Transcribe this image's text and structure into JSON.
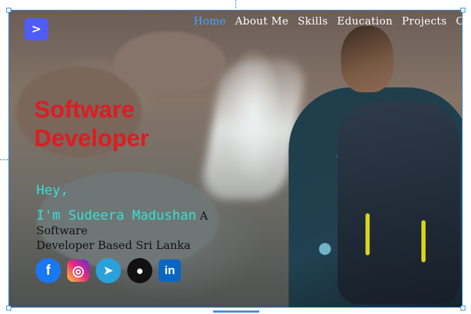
{
  "nav": {
    "logo_symbol": ">",
    "items": [
      {
        "label": "Home",
        "active": true
      },
      {
        "label": "About Me",
        "active": false
      },
      {
        "label": "Skills",
        "active": false
      },
      {
        "label": "Education",
        "active": false
      },
      {
        "label": "Projects",
        "active": false
      },
      {
        "label": "Contact",
        "active": false
      }
    ]
  },
  "hero": {
    "title_line1": "Software",
    "title_line2": "Developer",
    "greeting": "Hey,",
    "name_line": "I'm Sudeera Madushan",
    "tagline_part1": " A Software",
    "tagline_part2": "Developer Based Sri Lanka"
  },
  "socials": [
    {
      "name": "facebook-icon",
      "glyph": "f"
    },
    {
      "name": "instagram-icon",
      "glyph": "◎"
    },
    {
      "name": "telegram-icon",
      "glyph": "➤"
    },
    {
      "name": "github-icon",
      "glyph": "●"
    },
    {
      "name": "linkedin-icon",
      "glyph": "in"
    }
  ],
  "colors": {
    "accent_blue": "#4aa0ff",
    "title_red": "#e01b22",
    "greet_cyan": "#35e0d6",
    "logo_bg": "#4f5cf5"
  }
}
